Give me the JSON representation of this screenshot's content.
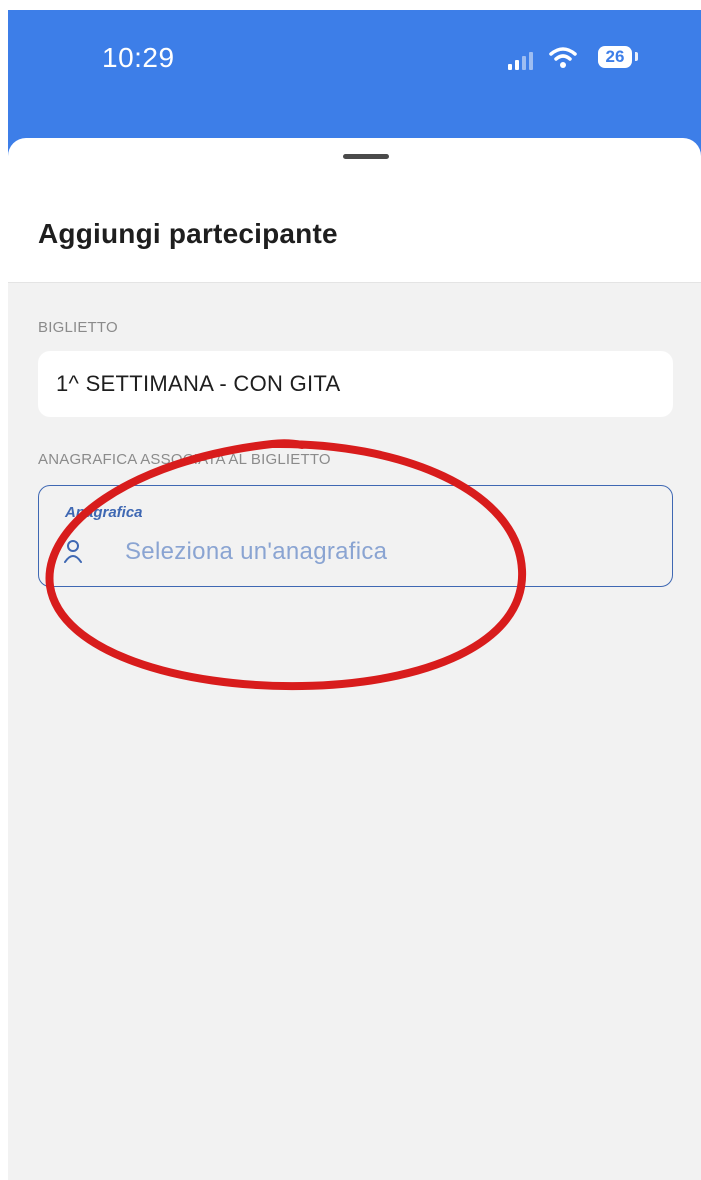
{
  "status_bar": {
    "time": "10:29",
    "battery": "26",
    "signal_icon": "cellular-signal-icon",
    "wifi_icon": "wifi-icon"
  },
  "sheet": {
    "title": "Aggiungi partecipante"
  },
  "ticket": {
    "section_label": "BIGLIETTO",
    "value": "1^ SETTIMANA - CON GITA"
  },
  "anagrafica": {
    "section_label": "ANAGRAFICA ASSOCIATA AL BIGLIETTO",
    "field_label": "Anagrafica",
    "placeholder": "Seleziona un'anagrafica",
    "icon": "person-icon"
  },
  "colors": {
    "header_blue": "#3d7ee8",
    "field_border": "#3f68b3",
    "placeholder": "#8aa4d2",
    "annotation_red": "#d81c1c"
  }
}
